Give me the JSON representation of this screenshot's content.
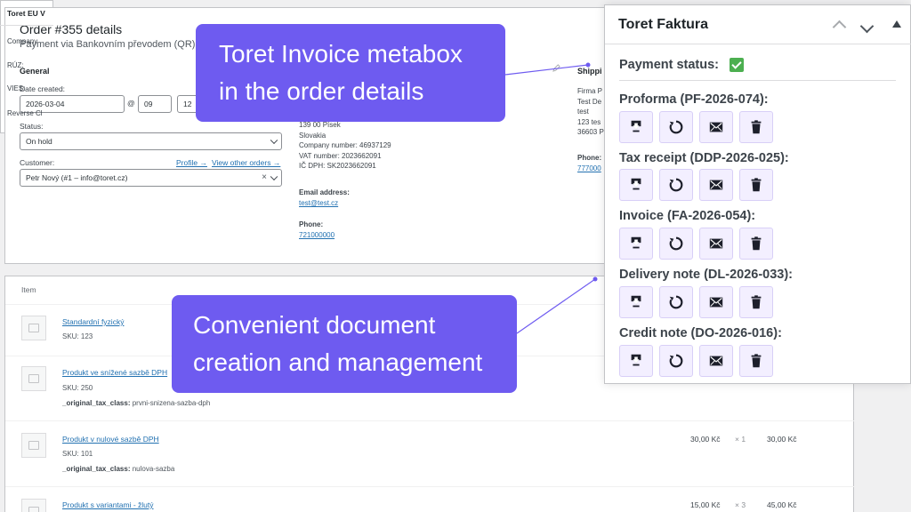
{
  "order": {
    "title": "Order #355 details",
    "subtitle": "Payment via Bankovním převodem (QR)",
    "general_heading": "General",
    "date_label": "Date created:",
    "date_value": "2026-03-04",
    "at_symbol": "@",
    "hour": "09",
    "minute": "12",
    "status_label": "Status:",
    "status_value": "On hold",
    "customer_label": "Customer:",
    "profile_link": "Profile →",
    "other_orders_link": "View other orders →",
    "customer_value": "Petr Nový (#1 – info@toret.cz)",
    "clear_symbol": "×",
    "billing": {
      "address_line": "139 00 Písek",
      "country": "Slovakia",
      "company_number": "Company number: 46937129",
      "vat_number": "VAT number: 2023662091",
      "ic_dph": "IČ DPH: SK2023662091",
      "email_label": "Email address:",
      "email_value": "test@test.cz",
      "phone_label": "Phone:",
      "phone_value": "721000000"
    },
    "shipping": {
      "heading": "Shippi",
      "line1": "Firma P",
      "line2": "Test De",
      "line3": "test",
      "line4": "123 tes",
      "line5": "36603 P",
      "phone_label": "Phone:",
      "phone_value": "777000"
    }
  },
  "items": {
    "column_header": "Item",
    "rows": [
      {
        "name": "Standardní fyzický",
        "sku": "SKU: 123"
      },
      {
        "name": "Produkt ve snížené sazbě DPH",
        "sku": "SKU: 250",
        "meta_key": "_original_tax_class:",
        "meta_value": "prvni-snizena-sazba-dph"
      },
      {
        "name": "Produkt v nulové sazbě DPH",
        "sku": "SKU: 101",
        "meta_key": "_original_tax_class:",
        "meta_value": "nulova-sazba",
        "cost": "30,00 Kč",
        "qty": "× 1",
        "total": "30,00 Kč"
      },
      {
        "name": "Produkt s variantami - žlutý",
        "cost": "15,00 Kč",
        "qty": "× 3",
        "total": "45,00 Kč"
      }
    ]
  },
  "eu_panel": {
    "title": "Toret EU V",
    "company": "Company",
    "ruz": "RÚZ:",
    "vies": "VIES:",
    "reverse": "Reverse Cl"
  },
  "faktura": {
    "title": "Toret Faktura",
    "payment_status_label": "Payment status:",
    "documents": [
      {
        "title": "Proforma (PF-2026-074):"
      },
      {
        "title": "Tax receipt (DDP-2026-025):"
      },
      {
        "title": "Invoice (FA-2026-054):"
      },
      {
        "title": "Delivery note (DL-2026-033):"
      },
      {
        "title": "Credit note (DO-2026-016):"
      }
    ],
    "accent_color": "#6e5bf0"
  },
  "callouts": {
    "c1_line1": "Toret Invoice metabox",
    "c1_line2": "in the order details",
    "c2_line1": "Convenient document",
    "c2_line2": "creation and management"
  }
}
